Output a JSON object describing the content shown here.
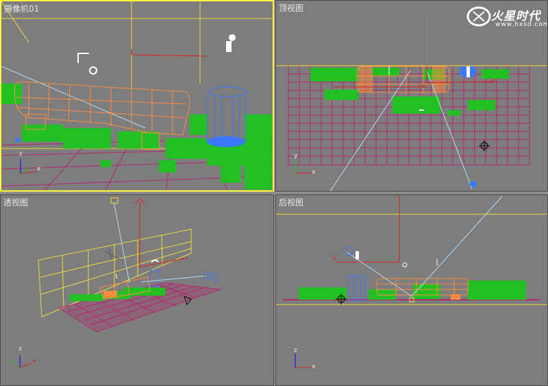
{
  "viewports": {
    "camera": {
      "label": "摄像机01",
      "active": true
    },
    "top": {
      "label": "顶视图"
    },
    "perspective": {
      "label": "透视图"
    },
    "back": {
      "label": "后视图"
    }
  },
  "axes": {
    "x": "x",
    "y": "y",
    "z": "z"
  },
  "watermark": {
    "brand": "火星时代",
    "site": "www.hxsd.com"
  },
  "colors": {
    "viewport_bg": "#7d7d7d",
    "active_border": "#ffff3c",
    "bench_wire": "#ff8c3c",
    "grass": "#22c022",
    "trash_can": "#3c78ff",
    "grid": "#b4286e",
    "camera_line": "#b4dcff",
    "gizmo_red": "#dc1e1e",
    "boundary": "#f0dc3c"
  }
}
